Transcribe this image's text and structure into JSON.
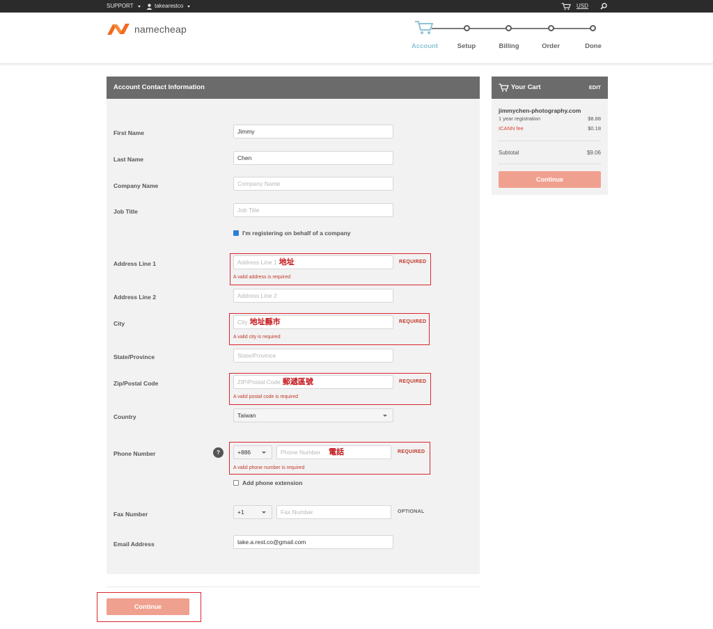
{
  "topbar": {
    "support": "SUPPORT",
    "username": "takearestco",
    "currency": "USD"
  },
  "logo": {
    "text": "namecheap"
  },
  "steps": [
    "Account",
    "Setup",
    "Billing",
    "Order",
    "Done"
  ],
  "form": {
    "title": "Account Contact Information",
    "first_name": {
      "label": "First Name",
      "value": "Jimmy"
    },
    "last_name": {
      "label": "Last Name",
      "value": "Chen"
    },
    "company": {
      "label": "Company Name",
      "placeholder": "Company Name"
    },
    "job_title": {
      "label": "Job Title",
      "placeholder": "Job Title"
    },
    "company_checkbox": {
      "label": "I'm registering on behalf of a company",
      "checked": true
    },
    "address1": {
      "label": "Address Line 1",
      "placeholder": "Address Line 1",
      "annotation": "地址",
      "required": "REQUIRED",
      "error": "A valid address is required"
    },
    "address2": {
      "label": "Address Line 2",
      "placeholder": "Address Line 2"
    },
    "city": {
      "label": "City",
      "placeholder": "City",
      "annotation": "地址縣市",
      "required": "REQUIRED",
      "error": "A valid city is required"
    },
    "state": {
      "label": "State/Province",
      "placeholder": "State/Province"
    },
    "zip": {
      "label": "Zip/Postal Code",
      "placeholder": "ZIP/Postal Code",
      "annotation": "郵遞區號",
      "required": "REQUIRED",
      "error": "A valid postal code is required"
    },
    "country": {
      "label": "Country",
      "value": "Taiwan"
    },
    "phone": {
      "label": "Phone Number",
      "code": "+886",
      "placeholder": "Phone Number",
      "annotation": "電話",
      "required": "REQUIRED",
      "error": "A valid phone number is required",
      "help": "?"
    },
    "phone_ext": {
      "label": "Add phone extension",
      "checked": false
    },
    "fax": {
      "label": "Fax Number",
      "code": "+1",
      "placeholder": "Fax Number",
      "optional": "OPTIONAL"
    },
    "email": {
      "label": "Email Address",
      "value": "take.a.rest.co@gmail.com"
    },
    "continue": "Continue"
  },
  "cart": {
    "title": "Your Cart",
    "edit": "EDIT",
    "domain": "jimmychen-photography.com",
    "reg_label": "1 year registration",
    "reg_price": "$8.88",
    "icann_label": "ICANN fee",
    "icann_price": "$0.18",
    "subtotal_label": "Subtotal",
    "subtotal": "$9.06",
    "continue": "Continue"
  },
  "colors": {
    "accent": "#f0a08f",
    "error": "#c0392b",
    "active_step": "#8ec2d6",
    "logo_orange": "#f26b21"
  }
}
